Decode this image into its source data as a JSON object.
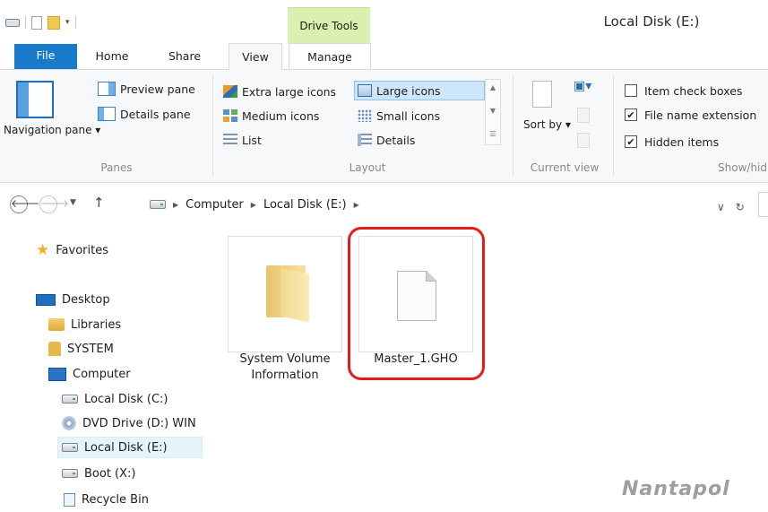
{
  "window": {
    "title": "Local Disk (E:)",
    "context_tab": "Drive Tools"
  },
  "tabs": {
    "file": "File",
    "home": "Home",
    "share": "Share",
    "view": "View",
    "manage": "Manage"
  },
  "ribbon": {
    "panes": {
      "navigation_pane": "Navigation pane ▾",
      "preview_pane": "Preview pane",
      "details_pane": "Details pane",
      "group_label": "Panes"
    },
    "layout": {
      "extra_large_icons": "Extra large icons",
      "large_icons": "Large icons",
      "medium_icons": "Medium icons",
      "small_icons": "Small icons",
      "list": "List",
      "details": "Details",
      "group_label": "Layout",
      "selected": "Large icons"
    },
    "current_view": {
      "sort_by": "Sort by ▾",
      "group_label": "Current view"
    },
    "show_hide": {
      "item_check_boxes": {
        "label": "Item check boxes",
        "checked": false
      },
      "file_name_extensions": {
        "label": "File name extension",
        "checked": true
      },
      "hidden_items": {
        "label": "Hidden items",
        "checked": true
      },
      "group_label": "Show/hid"
    }
  },
  "address": {
    "crumbs": [
      "Computer",
      "Local Disk (E:)"
    ]
  },
  "tree": {
    "items": [
      {
        "label": "Favorites",
        "icon": "star-icon"
      },
      {
        "label": "Desktop",
        "icon": "desktop-icon"
      },
      {
        "label": "Libraries",
        "icon": "libraries-icon"
      },
      {
        "label": "SYSTEM",
        "icon": "user-folder-icon"
      },
      {
        "label": "Computer",
        "icon": "computer-icon"
      },
      {
        "label": "Local Disk (C:)",
        "icon": "drive-icon"
      },
      {
        "label": "DVD Drive (D:) WIN",
        "icon": "dvd-icon"
      },
      {
        "label": "Local Disk (E:)",
        "icon": "drive-icon",
        "selected": true
      },
      {
        "label": "Boot (X:)",
        "icon": "drive-icon"
      },
      {
        "label": "Recycle Bin",
        "icon": "recycle-bin-icon"
      }
    ]
  },
  "files": [
    {
      "name": "System Volume Information",
      "name_line1": "System Volume",
      "name_line2": "Information",
      "type": "folder"
    },
    {
      "name": "Master_1.GHO",
      "type": "file",
      "highlighted": true
    }
  ],
  "watermark": "Nantapol",
  "colors": {
    "file_tab": "#1979ca",
    "context_tab": "#d9f0b0",
    "highlight": "#e41c1c",
    "selection": "#cde6fb"
  }
}
